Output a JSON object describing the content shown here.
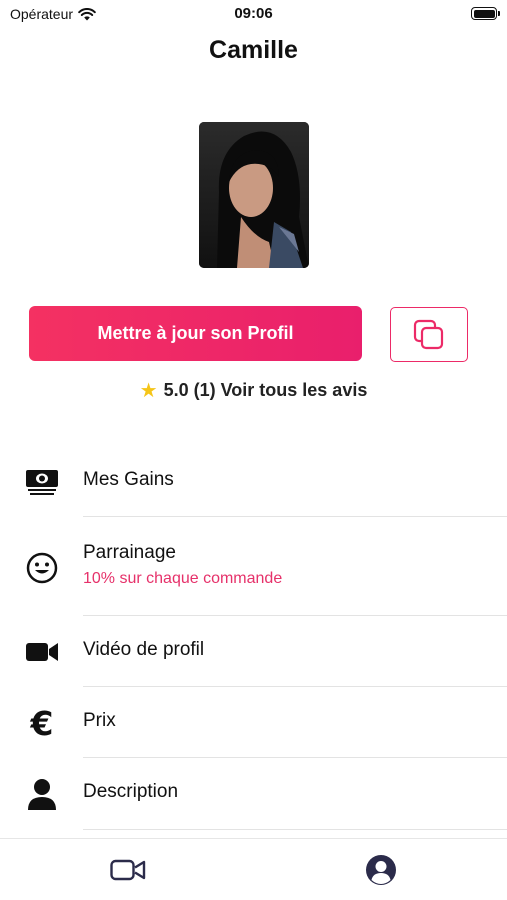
{
  "status_bar": {
    "carrier": "Opérateur",
    "time": "09:06"
  },
  "header": {
    "title": "Camille"
  },
  "profile": {
    "update_label": "Mettre à jour son Profil",
    "rating_value": "5.0 (1) Voir tous les avis"
  },
  "menu": {
    "items": [
      {
        "label": "Mes Gains",
        "icon": "money-icon"
      },
      {
        "label": "Parrainage",
        "sub": "10% sur chaque commande",
        "icon": "smiley-icon"
      },
      {
        "label": "Vidéo de profil",
        "icon": "video-camera-icon"
      },
      {
        "label": "Prix",
        "icon": "euro-icon"
      },
      {
        "label": "Description",
        "icon": "person-icon"
      }
    ]
  },
  "tab_bar": {
    "tabs": [
      {
        "icon": "video-camera-icon"
      },
      {
        "icon": "profile-icon"
      }
    ]
  },
  "colors": {
    "accent": "#ec2a67",
    "star": "#f5c518",
    "sub_text": "#e6316a"
  }
}
